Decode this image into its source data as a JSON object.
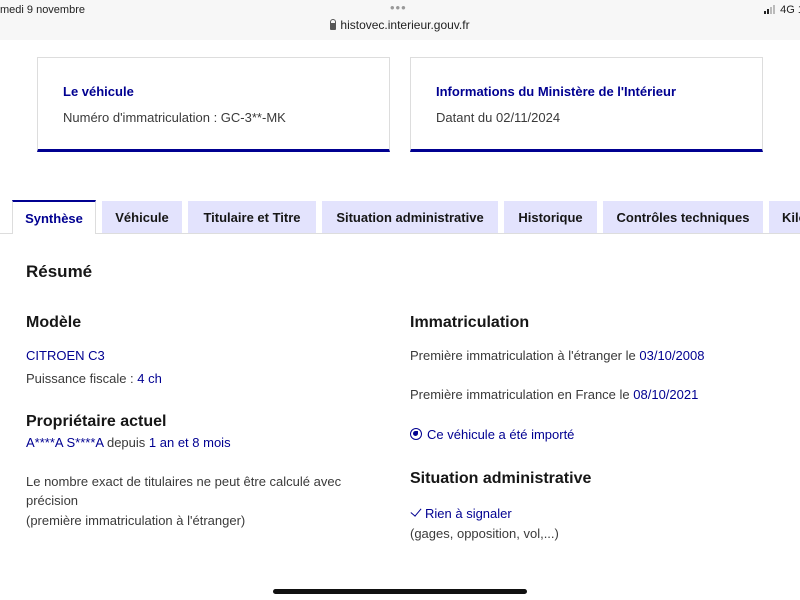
{
  "status_bar": {
    "left_text": "medi 9 novembre",
    "dots": "•••",
    "url": "histovec.interieur.gouv.fr",
    "network": "4G",
    "right_extra": "1"
  },
  "cards": [
    {
      "title": "Le véhicule",
      "text": "Numéro d'immatriculation : GC-3**-MK"
    },
    {
      "title": "Informations du Ministère de l'Intérieur",
      "text": "Datant du 02/11/2024"
    }
  ],
  "tabs": [
    {
      "label": "Synthèse",
      "active": true
    },
    {
      "label": "Véhicule"
    },
    {
      "label": "Titulaire et Titre"
    },
    {
      "label": "Situation administrative"
    },
    {
      "label": "Historique"
    },
    {
      "label": "Contrôles techniques"
    },
    {
      "label": "Kilo"
    }
  ],
  "summary": {
    "heading": "Résumé",
    "modele": {
      "heading": "Modèle",
      "name": "CITROEN C3",
      "puissance_label": "Puissance fiscale :",
      "puissance_value": "4 ch"
    },
    "proprietaire": {
      "heading": "Propriétaire actuel",
      "name": "A****A S****A",
      "depuis": "depuis",
      "duration": "1 an et 8 mois",
      "note_line1": "Le nombre exact de titulaires ne peut être calculé avec",
      "note_line2": "précision",
      "note_line3": "(première immatriculation à l'étranger)"
    },
    "immatriculation": {
      "heading": "Immatriculation",
      "etranger_label": "Première immatriculation à l'étranger le",
      "etranger_date": "03/10/2008",
      "france_label": "Première immatriculation en France le",
      "france_date": "08/10/2021",
      "imported": "Ce véhicule a été importé"
    },
    "situation": {
      "heading": "Situation administrative",
      "status": "Rien à signaler",
      "details": "(gages, opposition, vol,...)"
    }
  }
}
